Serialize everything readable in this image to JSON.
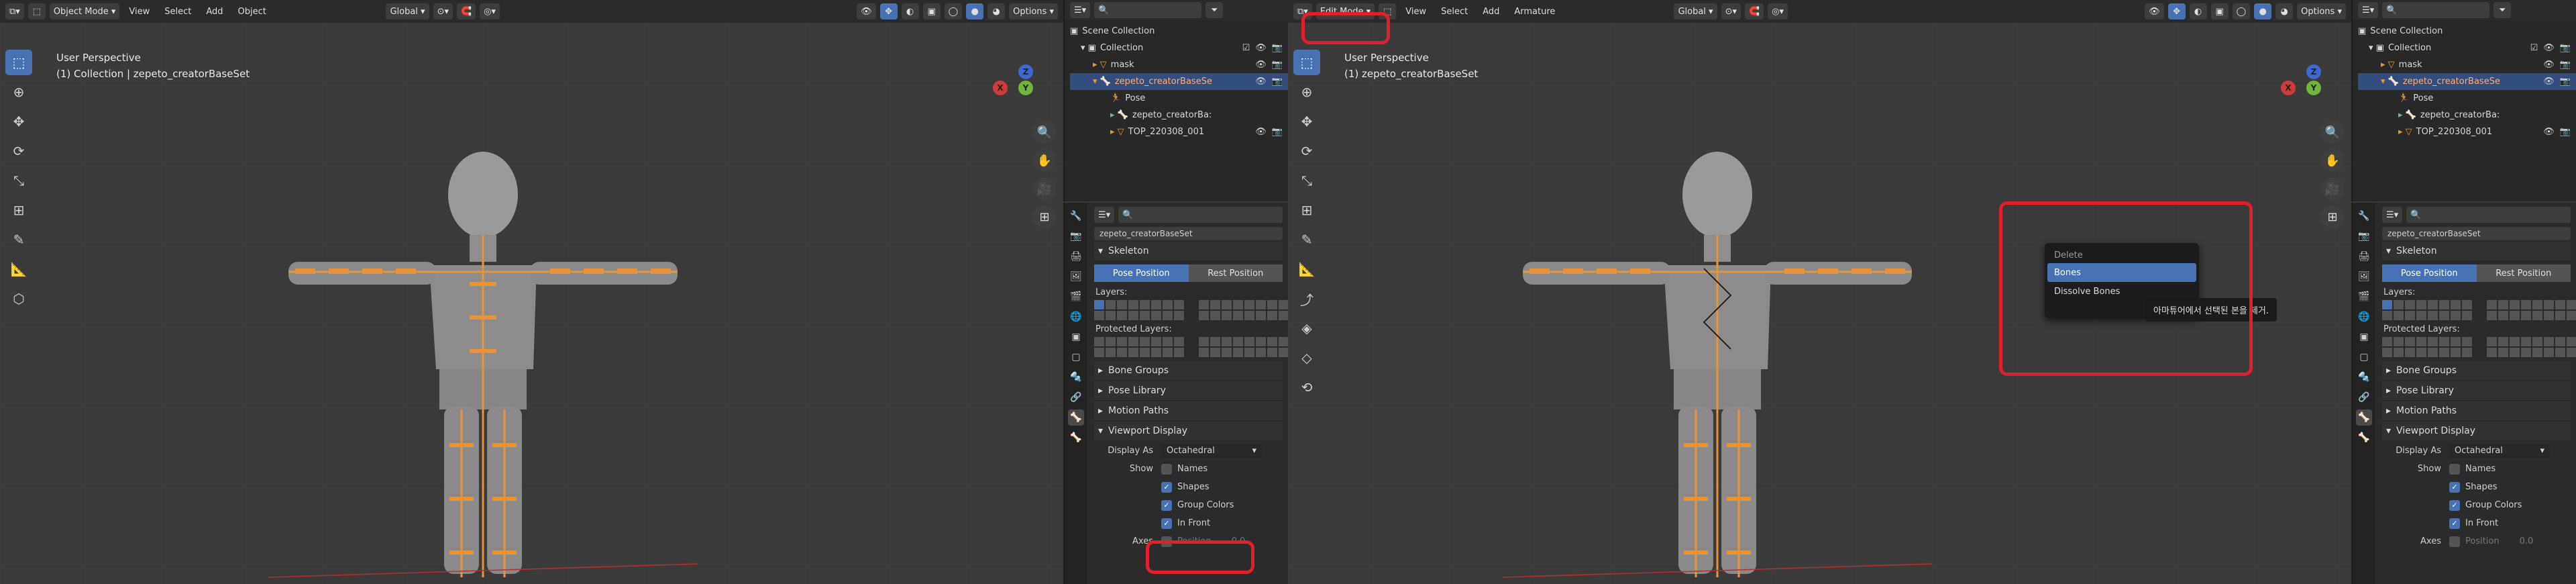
{
  "left": {
    "header": {
      "mode": "Object Mode",
      "menus": [
        "View",
        "Select",
        "Add",
        "Object"
      ],
      "transform": "Global",
      "options": "Options"
    },
    "viewport": {
      "perspective": "User Perspective",
      "collection": "(1) Collection | zepeto_creatorBaseSet"
    },
    "outliner": {
      "title": "Scene Collection",
      "rows": [
        "Collection",
        "mask",
        "zepeto_creatorBaseSe",
        "Pose",
        "zepeto_creatorBa:",
        "TOP_220308_001"
      ]
    },
    "props": {
      "object": "zepeto_creatorBaseSet",
      "skeleton": "Skeleton",
      "pose_btn": "Pose Position",
      "rest_btn": "Rest Position",
      "layers": "Layers:",
      "protected": "Protected Layers:",
      "bone_groups": "Bone Groups",
      "pose_library": "Pose Library",
      "motion_paths": "Motion Paths",
      "viewport_display": "Viewport Display",
      "display_as_label": "Display As",
      "display_as_value": "Octahedral",
      "show_label": "Show",
      "names": "Names",
      "shapes": "Shapes",
      "group_colors": "Group Colors",
      "in_front": "In Front",
      "axes": "Axes",
      "position": "Position",
      "position_val": "0.0"
    }
  },
  "right": {
    "header": {
      "mode": "Edit Mode",
      "menus": [
        "View",
        "Select",
        "Add",
        "Armature"
      ],
      "transform": "Global",
      "options": "Options"
    },
    "viewport": {
      "perspective": "User Perspective",
      "collection": "(1) zepeto_creatorBaseSet"
    },
    "menu": {
      "title": "Delete",
      "items": [
        "Bones",
        "Dissolve Bones"
      ]
    },
    "tooltip": "아마튜어에서 선택된 본을 제거.",
    "outliner": {
      "title": "Scene Collection",
      "rows": [
        "Collection",
        "mask",
        "zepeto_creatorBaseSe",
        "Pose",
        "zepeto_creatorBa:",
        "TOP_220308_001"
      ]
    },
    "props": {
      "object": "zepeto_creatorBaseSet",
      "skeleton": "Skeleton",
      "pose_btn": "Pose Position",
      "rest_btn": "Rest Position",
      "layers": "Layers:",
      "protected": "Protected Layers:",
      "bone_groups": "Bone Groups",
      "pose_library": "Pose Library",
      "motion_paths": "Motion Paths",
      "viewport_display": "Viewport Display",
      "display_as_label": "Display As",
      "display_as_value": "Octahedral",
      "show_label": "Show",
      "names": "Names",
      "shapes": "Shapes",
      "group_colors": "Group Colors",
      "in_front": "In Front",
      "axes": "Axes",
      "position": "Position",
      "position_val": "0.0"
    }
  },
  "colors": {
    "accent": "#4772b3",
    "highlight_red": "#e0202a",
    "bone_orange": "#e8933a"
  }
}
